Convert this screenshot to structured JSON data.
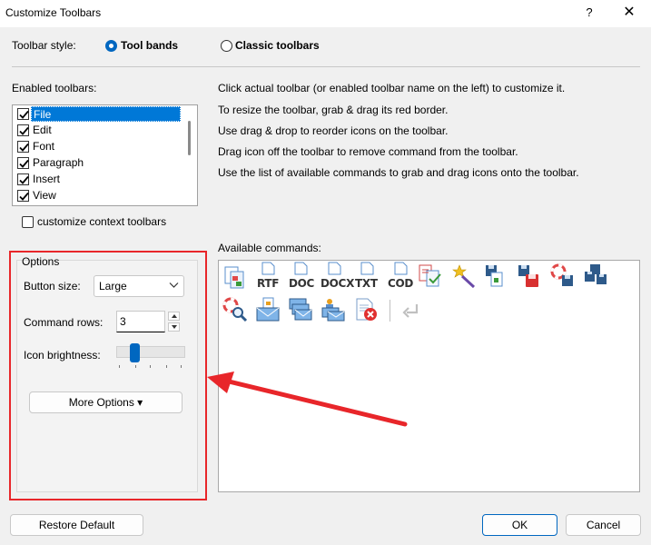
{
  "window": {
    "title": "Customize Toolbars",
    "help_glyph": "?",
    "close_glyph": "✕"
  },
  "toolbar_style": {
    "label": "Toolbar style:",
    "options": [
      {
        "label": "Tool bands",
        "selected": true
      },
      {
        "label": "Classic toolbars",
        "selected": false
      }
    ]
  },
  "enabled_toolbars": {
    "label": "Enabled toolbars:",
    "items": [
      {
        "label": "File",
        "checked": true,
        "selected": true
      },
      {
        "label": "Edit",
        "checked": true,
        "selected": false
      },
      {
        "label": "Font",
        "checked": true,
        "selected": false
      },
      {
        "label": "Paragraph",
        "checked": true,
        "selected": false
      },
      {
        "label": "Insert",
        "checked": true,
        "selected": false
      },
      {
        "label": "View",
        "checked": true,
        "selected": false
      }
    ],
    "context_checkbox": {
      "label": "customize context toolbars",
      "checked": false
    }
  },
  "instructions": [
    "Click actual toolbar (or enabled toolbar name on the left) to customize it.",
    "To resize the toolbar, grab & drag its red border.",
    "Use drag & drop to reorder icons on the toolbar.",
    "Drag icon off the toolbar to remove command from the toolbar.",
    "Use the list of available commands to grab and drag icons onto the toolbar."
  ],
  "options": {
    "title": "Options",
    "button_size": {
      "label": "Button size:",
      "value": "Large"
    },
    "command_rows": {
      "label": "Command rows:",
      "value": "3"
    },
    "icon_brightness": {
      "label": "Icon brightness:",
      "level": 0.25
    },
    "more_options": "More Options ▾"
  },
  "available": {
    "label": "Available commands:",
    "row1": [
      {
        "name": "copy-pages-icon",
        "label": ""
      },
      {
        "name": "rtf-icon",
        "label": "RTF"
      },
      {
        "name": "doc-icon",
        "label": "DOC"
      },
      {
        "name": "docx-icon",
        "label": "DOCX"
      },
      {
        "name": "txt-icon",
        "label": "TXT"
      },
      {
        "name": "cod-icon",
        "label": "COD"
      },
      {
        "name": "compare-docs-icon",
        "label": ""
      },
      {
        "name": "magic-wand-icon",
        "label": ""
      },
      {
        "name": "save-copy-icon",
        "label": ""
      },
      {
        "name": "save-red-icon",
        "label": ""
      },
      {
        "name": "save-lifebuoy-icon",
        "label": ""
      },
      {
        "name": "save-all-icon",
        "label": ""
      }
    ],
    "row2": [
      {
        "name": "lifebuoy-search-icon"
      },
      {
        "name": "mail-document-icon"
      },
      {
        "name": "mail-stack-icon"
      },
      {
        "name": "mail-merge-icon"
      },
      {
        "name": "document-delete-icon"
      },
      {
        "name": "return-arrow-icon"
      }
    ]
  },
  "buttons": {
    "restore": "Restore Default",
    "ok": "OK",
    "cancel": "Cancel"
  },
  "colors": {
    "accent": "#0067c0",
    "annotation_red": "#e8262a"
  }
}
